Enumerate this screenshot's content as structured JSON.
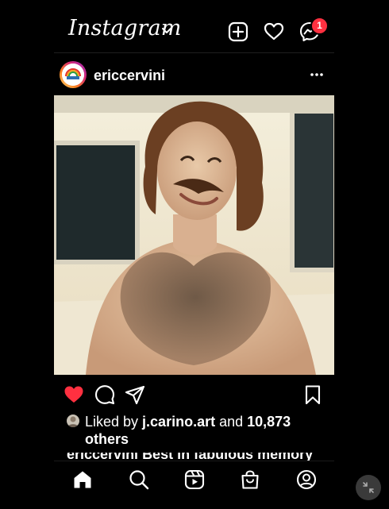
{
  "app": {
    "title": "Instagram"
  },
  "header": {
    "notification_count": "1"
  },
  "post": {
    "username": "ericcervini",
    "liked_by_prefix": "Liked by ",
    "liked_by_user": "j.carino.art",
    "liked_by_mid": " and ",
    "likes_count": "10,873",
    "likes_suffix": "others",
    "caption_partial": "ericcervini Best in fabulous memory",
    "liked": true
  },
  "colors": {
    "like_red": "#ff3040",
    "badge_red": "#ff3040"
  },
  "icons": {
    "top": [
      "plus-square-icon",
      "heart-icon",
      "messenger-icon"
    ],
    "actions": [
      "heart-filled-icon",
      "comment-icon",
      "share-icon",
      "bookmark-icon"
    ],
    "nav": [
      "home-icon",
      "search-icon",
      "reels-icon",
      "shop-icon",
      "profile-icon"
    ]
  }
}
